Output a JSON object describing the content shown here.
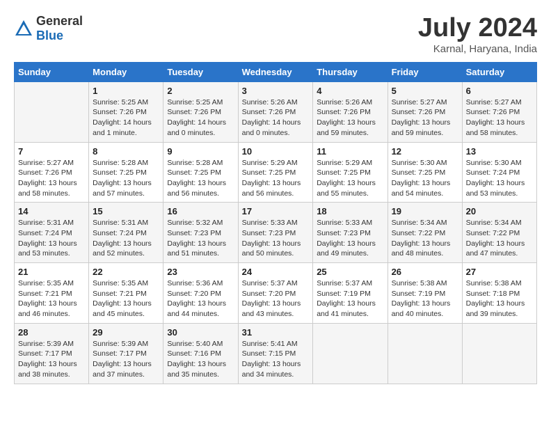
{
  "header": {
    "logo_general": "General",
    "logo_blue": "Blue",
    "title": "July 2024",
    "subtitle": "Karnal, Haryana, India"
  },
  "calendar": {
    "days_of_week": [
      "Sunday",
      "Monday",
      "Tuesday",
      "Wednesday",
      "Thursday",
      "Friday",
      "Saturday"
    ],
    "weeks": [
      [
        {
          "day": "",
          "info": ""
        },
        {
          "day": "1",
          "info": "Sunrise: 5:25 AM\nSunset: 7:26 PM\nDaylight: 14 hours\nand 1 minute."
        },
        {
          "day": "2",
          "info": "Sunrise: 5:25 AM\nSunset: 7:26 PM\nDaylight: 14 hours\nand 0 minutes."
        },
        {
          "day": "3",
          "info": "Sunrise: 5:26 AM\nSunset: 7:26 PM\nDaylight: 14 hours\nand 0 minutes."
        },
        {
          "day": "4",
          "info": "Sunrise: 5:26 AM\nSunset: 7:26 PM\nDaylight: 13 hours\nand 59 minutes."
        },
        {
          "day": "5",
          "info": "Sunrise: 5:27 AM\nSunset: 7:26 PM\nDaylight: 13 hours\nand 59 minutes."
        },
        {
          "day": "6",
          "info": "Sunrise: 5:27 AM\nSunset: 7:26 PM\nDaylight: 13 hours\nand 58 minutes."
        }
      ],
      [
        {
          "day": "7",
          "info": "Sunrise: 5:27 AM\nSunset: 7:26 PM\nDaylight: 13 hours\nand 58 minutes."
        },
        {
          "day": "8",
          "info": "Sunrise: 5:28 AM\nSunset: 7:25 PM\nDaylight: 13 hours\nand 57 minutes."
        },
        {
          "day": "9",
          "info": "Sunrise: 5:28 AM\nSunset: 7:25 PM\nDaylight: 13 hours\nand 56 minutes."
        },
        {
          "day": "10",
          "info": "Sunrise: 5:29 AM\nSunset: 7:25 PM\nDaylight: 13 hours\nand 56 minutes."
        },
        {
          "day": "11",
          "info": "Sunrise: 5:29 AM\nSunset: 7:25 PM\nDaylight: 13 hours\nand 55 minutes."
        },
        {
          "day": "12",
          "info": "Sunrise: 5:30 AM\nSunset: 7:25 PM\nDaylight: 13 hours\nand 54 minutes."
        },
        {
          "day": "13",
          "info": "Sunrise: 5:30 AM\nSunset: 7:24 PM\nDaylight: 13 hours\nand 53 minutes."
        }
      ],
      [
        {
          "day": "14",
          "info": "Sunrise: 5:31 AM\nSunset: 7:24 PM\nDaylight: 13 hours\nand 53 minutes."
        },
        {
          "day": "15",
          "info": "Sunrise: 5:31 AM\nSunset: 7:24 PM\nDaylight: 13 hours\nand 52 minutes."
        },
        {
          "day": "16",
          "info": "Sunrise: 5:32 AM\nSunset: 7:23 PM\nDaylight: 13 hours\nand 51 minutes."
        },
        {
          "day": "17",
          "info": "Sunrise: 5:33 AM\nSunset: 7:23 PM\nDaylight: 13 hours\nand 50 minutes."
        },
        {
          "day": "18",
          "info": "Sunrise: 5:33 AM\nSunset: 7:23 PM\nDaylight: 13 hours\nand 49 minutes."
        },
        {
          "day": "19",
          "info": "Sunrise: 5:34 AM\nSunset: 7:22 PM\nDaylight: 13 hours\nand 48 minutes."
        },
        {
          "day": "20",
          "info": "Sunrise: 5:34 AM\nSunset: 7:22 PM\nDaylight: 13 hours\nand 47 minutes."
        }
      ],
      [
        {
          "day": "21",
          "info": "Sunrise: 5:35 AM\nSunset: 7:21 PM\nDaylight: 13 hours\nand 46 minutes."
        },
        {
          "day": "22",
          "info": "Sunrise: 5:35 AM\nSunset: 7:21 PM\nDaylight: 13 hours\nand 45 minutes."
        },
        {
          "day": "23",
          "info": "Sunrise: 5:36 AM\nSunset: 7:20 PM\nDaylight: 13 hours\nand 44 minutes."
        },
        {
          "day": "24",
          "info": "Sunrise: 5:37 AM\nSunset: 7:20 PM\nDaylight: 13 hours\nand 43 minutes."
        },
        {
          "day": "25",
          "info": "Sunrise: 5:37 AM\nSunset: 7:19 PM\nDaylight: 13 hours\nand 41 minutes."
        },
        {
          "day": "26",
          "info": "Sunrise: 5:38 AM\nSunset: 7:19 PM\nDaylight: 13 hours\nand 40 minutes."
        },
        {
          "day": "27",
          "info": "Sunrise: 5:38 AM\nSunset: 7:18 PM\nDaylight: 13 hours\nand 39 minutes."
        }
      ],
      [
        {
          "day": "28",
          "info": "Sunrise: 5:39 AM\nSunset: 7:17 PM\nDaylight: 13 hours\nand 38 minutes."
        },
        {
          "day": "29",
          "info": "Sunrise: 5:39 AM\nSunset: 7:17 PM\nDaylight: 13 hours\nand 37 minutes."
        },
        {
          "day": "30",
          "info": "Sunrise: 5:40 AM\nSunset: 7:16 PM\nDaylight: 13 hours\nand 35 minutes."
        },
        {
          "day": "31",
          "info": "Sunrise: 5:41 AM\nSunset: 7:15 PM\nDaylight: 13 hours\nand 34 minutes."
        },
        {
          "day": "",
          "info": ""
        },
        {
          "day": "",
          "info": ""
        },
        {
          "day": "",
          "info": ""
        }
      ]
    ]
  }
}
